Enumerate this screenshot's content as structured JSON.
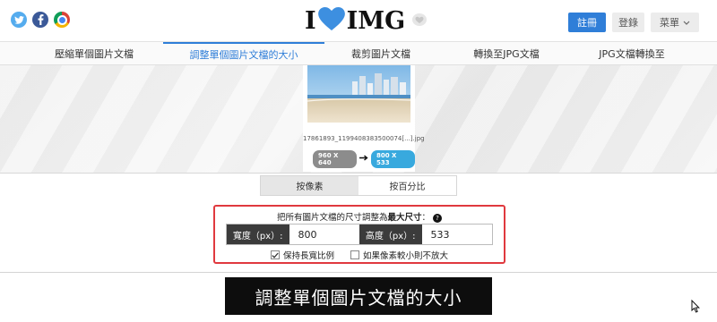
{
  "header": {
    "social_icons": [
      "twitter-icon",
      "facebook-icon",
      "chrome-icon"
    ],
    "logo": {
      "left": "I",
      "right": "IMG",
      "heart_color": "#3d8fe0"
    },
    "register": "註冊",
    "login": "登錄",
    "menu": "菜單",
    "accent": "#2f7ed8"
  },
  "nav": {
    "items": [
      {
        "label": "壓縮單個圖片文檔"
      },
      {
        "label": "調整單個圖片文檔的大小",
        "active": true
      },
      {
        "label": "裁剪圖片文檔"
      },
      {
        "label": "轉換至JPG文檔"
      },
      {
        "label": "JPG文檔轉換至"
      }
    ]
  },
  "preview": {
    "filename": "17861893_1199408383500074[...].jpg",
    "original_size": "960 X 640",
    "new_size": "800 X 533"
  },
  "modes": {
    "pixels": "按像素",
    "percent": "按百分比",
    "selected": "pixels"
  },
  "resize": {
    "title_prefix": "把所有圖片文檔的尺寸調整為",
    "title_bold": "最大尺寸",
    "title_suffix": "：",
    "help": "?",
    "width_label": "寬度（px）:",
    "width_value": "800",
    "height_label": "高度（px）:",
    "height_value": "533",
    "keep_ratio_label": "保持長寬比例",
    "keep_ratio_checked": true,
    "no_upscale_label": "如果像素較小則不放大",
    "no_upscale_checked": false,
    "highlight_color": "#e0393e"
  },
  "submit": "調整單個圖片文檔的大小"
}
